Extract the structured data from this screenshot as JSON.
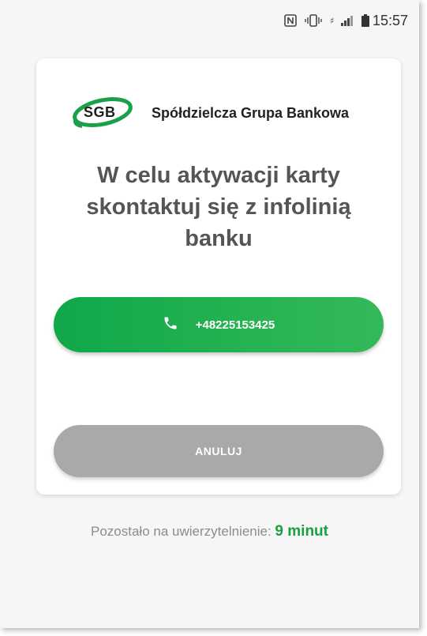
{
  "status_bar": {
    "time": "15:57",
    "icons": [
      "nfc-icon",
      "vibrate-icon",
      "signal-icon",
      "battery-icon"
    ]
  },
  "brand": {
    "logo_text": "SGB",
    "name": "Spółdzielcza Grupa Bankowa",
    "accent": "#1aa049"
  },
  "message": {
    "title": "W celu aktywacji karty skontaktuj się z infolinią banku"
  },
  "buttons": {
    "call_label": "+48225153425",
    "cancel_label": "ANULUJ"
  },
  "timer": {
    "prefix": "Pozostało na uwierzytelnienie:",
    "value": "9 minut"
  }
}
